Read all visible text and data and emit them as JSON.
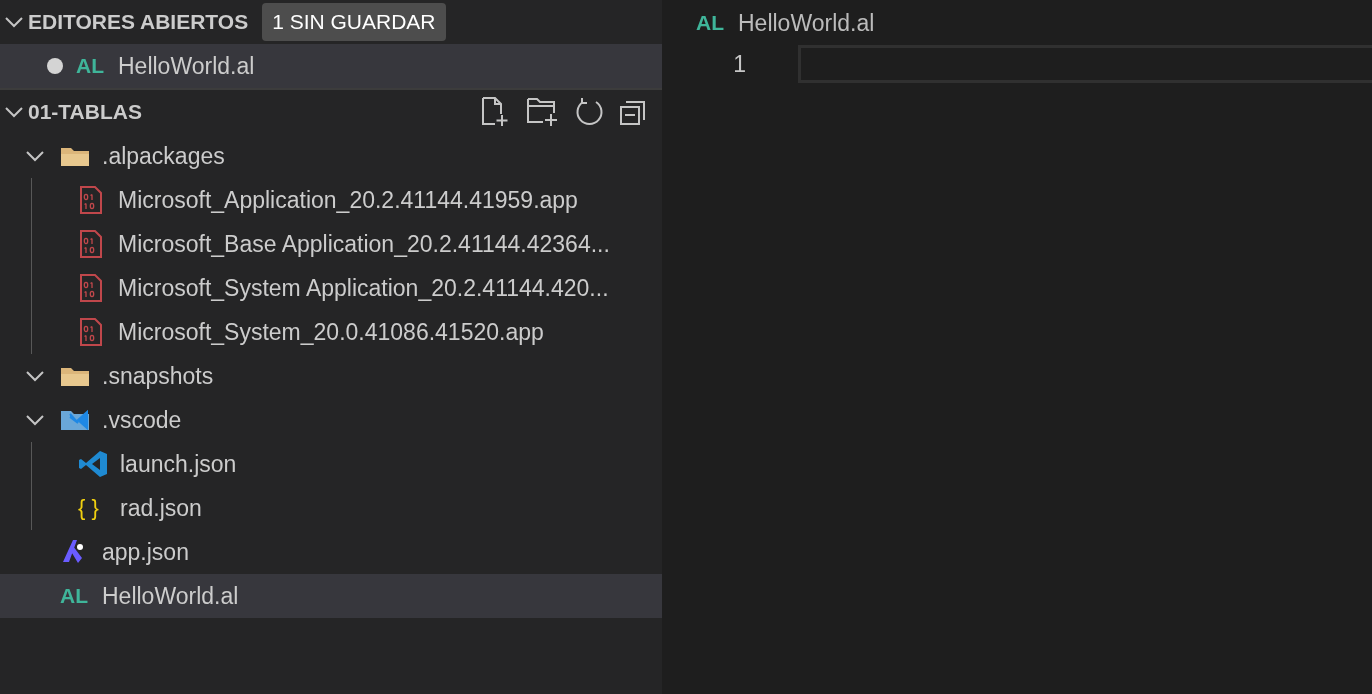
{
  "open_editors": {
    "title": "EDITORES ABIERTOS",
    "expanded": true,
    "badge": "1 SIN GUARDAR",
    "items": [
      {
        "name": "HelloWorld.al",
        "icon_text": "AL",
        "unsaved": true,
        "selected": true
      }
    ]
  },
  "explorer": {
    "title": "01-TABLAS",
    "expanded": true,
    "items": [
      {
        "name": ".alpackages",
        "kind": "folder",
        "expanded": true,
        "selected": false,
        "children": [
          {
            "name": "Microsoft_Application_20.2.41144.41959.app",
            "kind": "binary",
            "selected": false
          },
          {
            "name": "Microsoft_Base Application_20.2.41144.42364...",
            "kind": "binary",
            "selected": false
          },
          {
            "name": "Microsoft_System Application_20.2.41144.420...",
            "kind": "binary",
            "selected": false
          },
          {
            "name": "Microsoft_System_20.0.41086.41520.app",
            "kind": "binary",
            "selected": false
          }
        ]
      },
      {
        "name": ".snapshots",
        "kind": "folder",
        "expanded": true,
        "selected": false
      },
      {
        "name": ".vscode",
        "kind": "vscode-folder",
        "expanded": true,
        "selected": false,
        "children": [
          {
            "name": "launch.json",
            "kind": "vscode",
            "selected": false
          },
          {
            "name": "rad.json",
            "kind": "json",
            "icon_text": "{ }",
            "selected": false
          }
        ]
      },
      {
        "name": "app.json",
        "kind": "app",
        "selected": false
      },
      {
        "name": "HelloWorld.al",
        "kind": "al",
        "icon_text": "AL",
        "selected": true
      }
    ]
  },
  "editor": {
    "tab": {
      "name": "HelloWorld.al",
      "icon_text": "AL"
    },
    "lines": [
      {
        "number": "1",
        "current": true
      }
    ]
  }
}
